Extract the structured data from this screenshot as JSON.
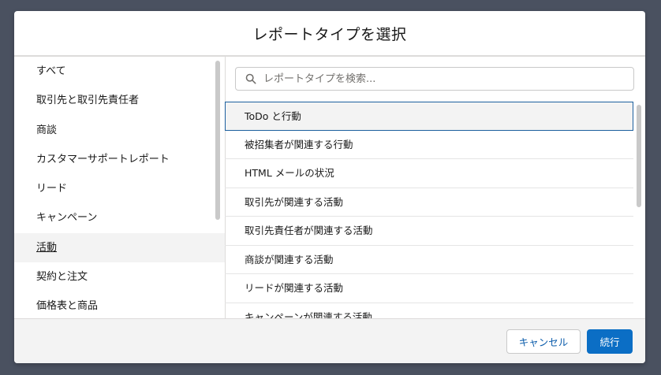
{
  "modal": {
    "title": "レポートタイプを選択"
  },
  "categories": [
    {
      "label": "すべて"
    },
    {
      "label": "取引先と取引先責任者"
    },
    {
      "label": "商談"
    },
    {
      "label": "カスタマーサポートレポート"
    },
    {
      "label": "リード"
    },
    {
      "label": "キャンペーン"
    },
    {
      "label": "活動",
      "active": true
    },
    {
      "label": "契約と注文"
    },
    {
      "label": "価格表と商品"
    }
  ],
  "search": {
    "placeholder": "レポートタイプを検索..."
  },
  "report_types": [
    {
      "label": "ToDo と行動",
      "selected": true
    },
    {
      "label": "被招集者が関連する行動"
    },
    {
      "label": "HTML メールの状況"
    },
    {
      "label": "取引先が関連する活動"
    },
    {
      "label": "取引先責任者が関連する活動"
    },
    {
      "label": "商談が関連する活動"
    },
    {
      "label": "リードが関連する活動"
    },
    {
      "label": "キャンペーンが関連する活動"
    }
  ],
  "footer": {
    "cancel_label": "キャンセル",
    "continue_label": "続行"
  },
  "colors": {
    "overlay": "#4a5160",
    "primary_button": "#0b6ec5",
    "selection_border": "#1b5f9e",
    "active_background": "#f3f3f3"
  },
  "icons": {
    "search": "search-icon"
  }
}
